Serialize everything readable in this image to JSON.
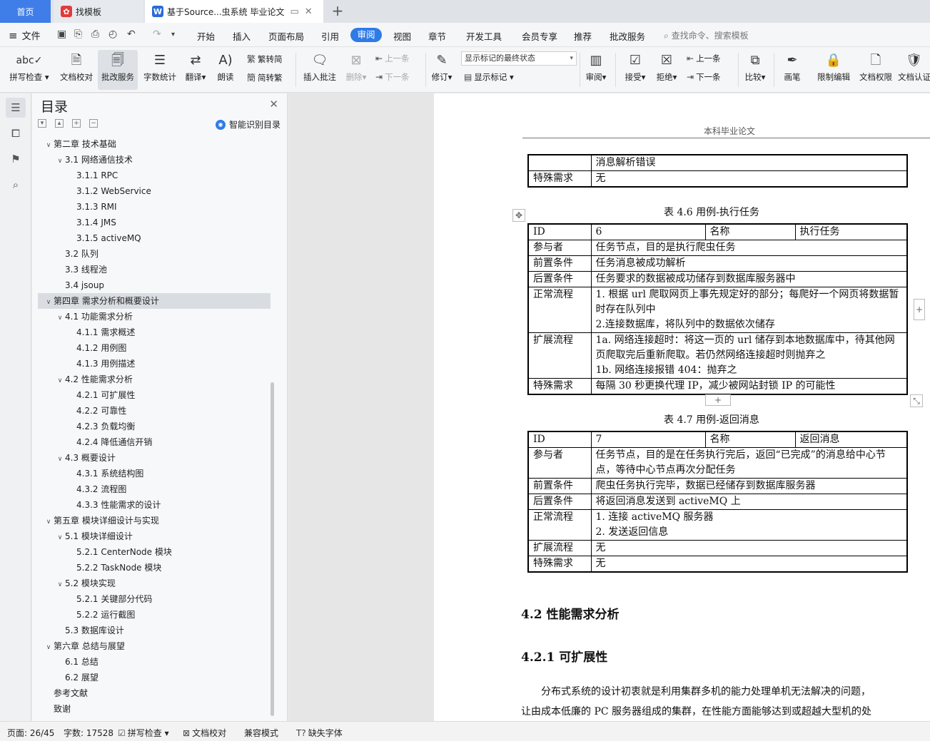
{
  "tabs": [
    {
      "label": "首页"
    },
    {
      "label": "找模板",
      "icon": "template-logo-icon"
    },
    {
      "label": "基于Source...虫系统 毕业论文",
      "icon": "wps-writer-icon"
    }
  ],
  "menu": {
    "file": "文件",
    "items": [
      "开始",
      "插入",
      "页面布局",
      "引用",
      "审阅",
      "视图",
      "章节",
      "开发工具",
      "会员专享",
      "推荐",
      "批改服务"
    ],
    "active": "审阅",
    "search_placeholder": "查找命令、搜索模板"
  },
  "ribbon": {
    "spell_check": "拼写检查",
    "doc_proof": "文档校对",
    "revise_service": "批改服务",
    "word_count": "字数统计",
    "translate": "翻译",
    "read_aloud": "朗读",
    "trad_to_simp": "繁转简",
    "simp_to_trad": "简转繁",
    "insert_comment": "插入批注",
    "delete": "删除",
    "prev_comment": "上一条",
    "next_comment": "下一条",
    "track_changes": "修订",
    "markup_mode": "显示标记的最终状态",
    "show_markup": "显示标记",
    "review_pane": "审阅",
    "accept": "接受",
    "reject": "拒绝",
    "prev_change": "上一条",
    "next_change": "下一条",
    "compare": "比较",
    "pen": "画笔",
    "restrict_edit": "限制编辑",
    "doc_permission": "文档权限",
    "doc_cert": "文档认证"
  },
  "toc": {
    "title": "目录",
    "smart_label": "智能识别目录",
    "items": [
      {
        "text": "第二章  技术基础",
        "level": 1,
        "chevron": true
      },
      {
        "text": "3.1  网络通信技术",
        "level": 2,
        "chevron": true
      },
      {
        "text": "3.1.1 RPC",
        "level": 3
      },
      {
        "text": "3.1.2 WebService",
        "level": 3
      },
      {
        "text": "3.1.3 RMI",
        "level": 3
      },
      {
        "text": "3.1.4 JMS",
        "level": 3
      },
      {
        "text": "3.1.5 activeMQ",
        "level": 3
      },
      {
        "text": "3.2  队列",
        "level": 2
      },
      {
        "text": "3.3  线程池",
        "level": 2
      },
      {
        "text": "3.4 jsoup",
        "level": 2
      },
      {
        "text": "第四章  需求分析和概要设计",
        "level": 1,
        "chevron": true,
        "selected": true
      },
      {
        "text": "4.1  功能需求分析",
        "level": 2,
        "chevron": true
      },
      {
        "text": "4.1.1  需求概述",
        "level": 3
      },
      {
        "text": "4.1.2  用例图",
        "level": 3
      },
      {
        "text": "4.1.3  用例描述",
        "level": 3
      },
      {
        "text": "4.2  性能需求分析",
        "level": 2,
        "chevron": true
      },
      {
        "text": "4.2.1  可扩展性",
        "level": 3
      },
      {
        "text": "4.2.2  可靠性",
        "level": 3
      },
      {
        "text": "4.2.3  负载均衡",
        "level": 3
      },
      {
        "text": "4.2.4  降低通信开销",
        "level": 3
      },
      {
        "text": "4.3  概要设计",
        "level": 2,
        "chevron": true
      },
      {
        "text": "4.3.1  系统结构图",
        "level": 3
      },
      {
        "text": "4.3.2  流程图",
        "level": 3
      },
      {
        "text": "4.3.3  性能需求的设计",
        "level": 3
      },
      {
        "text": "第五章  模块详细设计与实现",
        "level": 1,
        "chevron": true
      },
      {
        "text": "5.1  模块详细设计",
        "level": 2,
        "chevron": true
      },
      {
        "text": "5.2.1 CenterNode 模块",
        "level": 3
      },
      {
        "text": "5.2.2 TaskNode 模块",
        "level": 3
      },
      {
        "text": "5.2  模块实现",
        "level": 2,
        "chevron": true
      },
      {
        "text": "5.2.1  关键部分代码",
        "level": 3
      },
      {
        "text": "5.2.2  运行截图",
        "level": 3
      },
      {
        "text": "5.3  数据库设计",
        "level": 2
      },
      {
        "text": "第六章  总结与展望",
        "level": 1,
        "chevron": true
      },
      {
        "text": "6.1  总结",
        "level": 2
      },
      {
        "text": "6.2  展望",
        "level": 2
      },
      {
        "text": "参考文献",
        "level": 1
      },
      {
        "text": "致谢",
        "level": 1
      }
    ]
  },
  "document": {
    "header": "本科毕业论文",
    "table_prev": {
      "rows": [
        [
          "",
          "消息解析错误"
        ],
        [
          "特殊需求",
          "无"
        ]
      ]
    },
    "table_46": {
      "caption": "表 4.6  用例-执行任务",
      "id_label": "ID",
      "id_value": "6",
      "name_label": "名称",
      "name_value": "执行任务",
      "rows": [
        [
          "参与者",
          "任务节点，目的是执行爬虫任务"
        ],
        [
          "前置条件",
          "任务消息被成功解析"
        ],
        [
          "后置条件",
          "任务要求的数据被成功储存到数据库服务器中"
        ],
        [
          "正常流程",
          "1. 根据 url 爬取网页上事先规定好的部分；每爬好一个网页将数据暂时存在队列中\n2.连接数据库，将队列中的数据依次储存"
        ],
        [
          "扩展流程",
          "1a. 网络连接超时：将这一页的 url 储存到本地数据库中，待其他网页爬取完后重新爬取。若仍然网络连接超时则抛弃之\n1b. 网络连接报错 404：抛弃之"
        ],
        [
          "特殊需求",
          "每隔 30 秒更换代理 IP，减少被网站封锁 IP 的可能性"
        ]
      ]
    },
    "table_47": {
      "caption": "表 4.7  用例-返回消息",
      "id_label": "ID",
      "id_value": "7",
      "name_label": "名称",
      "name_value": "返回消息",
      "rows": [
        [
          "参与者",
          "任务节点，目的是在任务执行完后，返回“已完成”的消息给中心节点，等待中心节点再次分配任务"
        ],
        [
          "前置条件",
          "爬虫任务执行完毕，数据已经储存到数据库服务器"
        ],
        [
          "后置条件",
          "将返回消息发送到 activeMQ 上"
        ],
        [
          "正常流程",
          "1.  连接 activeMQ 服务器\n2.  发送返回信息"
        ],
        [
          "扩展流程",
          "无"
        ],
        [
          "特殊需求",
          "无"
        ]
      ]
    },
    "heading_42": "4.2  性能需求分析",
    "heading_421": "4.2.1  可扩展性",
    "para_1": "分布式系统的设计初衷就是利用集群多机的能力处理单机无法解决的问题，",
    "para_2": "让由成本低廉的 PC 服务器组成的集群，在性能方面能够达到或超越大型机的处"
  },
  "status": {
    "page": "页面: 26/45",
    "words": "字数: 17528",
    "spell": "拼写检查",
    "proof": "文档校对",
    "compat": "兼容模式",
    "missing_font": "缺失字体"
  }
}
